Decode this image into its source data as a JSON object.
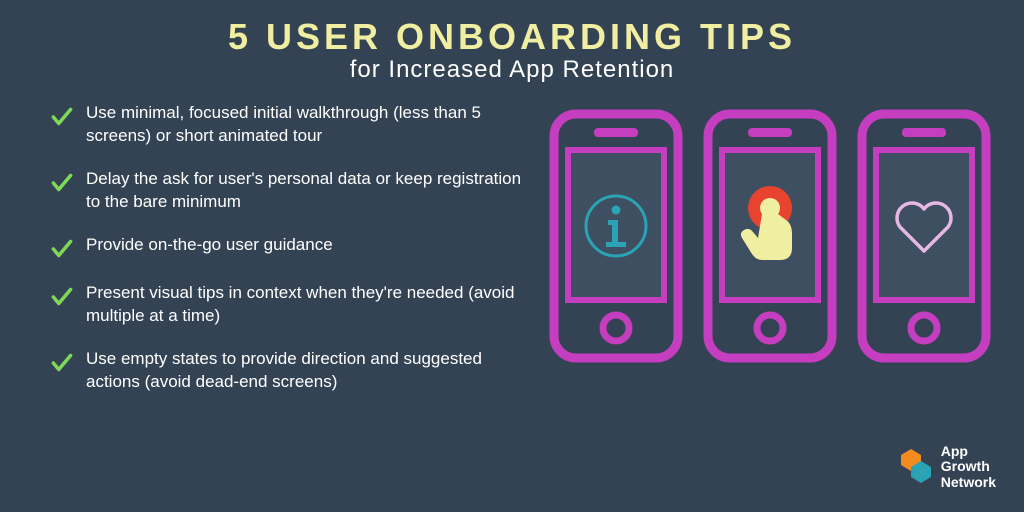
{
  "header": {
    "title": "5 USER ONBOARDING TIPS",
    "subtitle": "for Increased App Retention"
  },
  "tips": [
    "Use minimal, focused initial walkthrough (less than 5 screens) or short animated tour",
    "Delay the ask for user's personal data or keep registration to the bare minimum",
    "Provide on-the-go user guidance",
    "Present visual tips in context when they're needed (avoid multiple at a time)",
    "Use empty states to provide direction and suggested actions (avoid dead-end screens)"
  ],
  "phones": [
    {
      "icon": "info"
    },
    {
      "icon": "touch"
    },
    {
      "icon": "heart"
    }
  ],
  "logo": {
    "line1": "App",
    "line2": "Growth",
    "line3": "Network"
  },
  "colors": {
    "bg": "#334354",
    "title": "#f0eea0",
    "check": "#7ed957",
    "phone": "#c53ec0",
    "screen": "#3d4f61",
    "logoHex1": "#f28c1f",
    "logoHex2": "#2aa3b5"
  }
}
